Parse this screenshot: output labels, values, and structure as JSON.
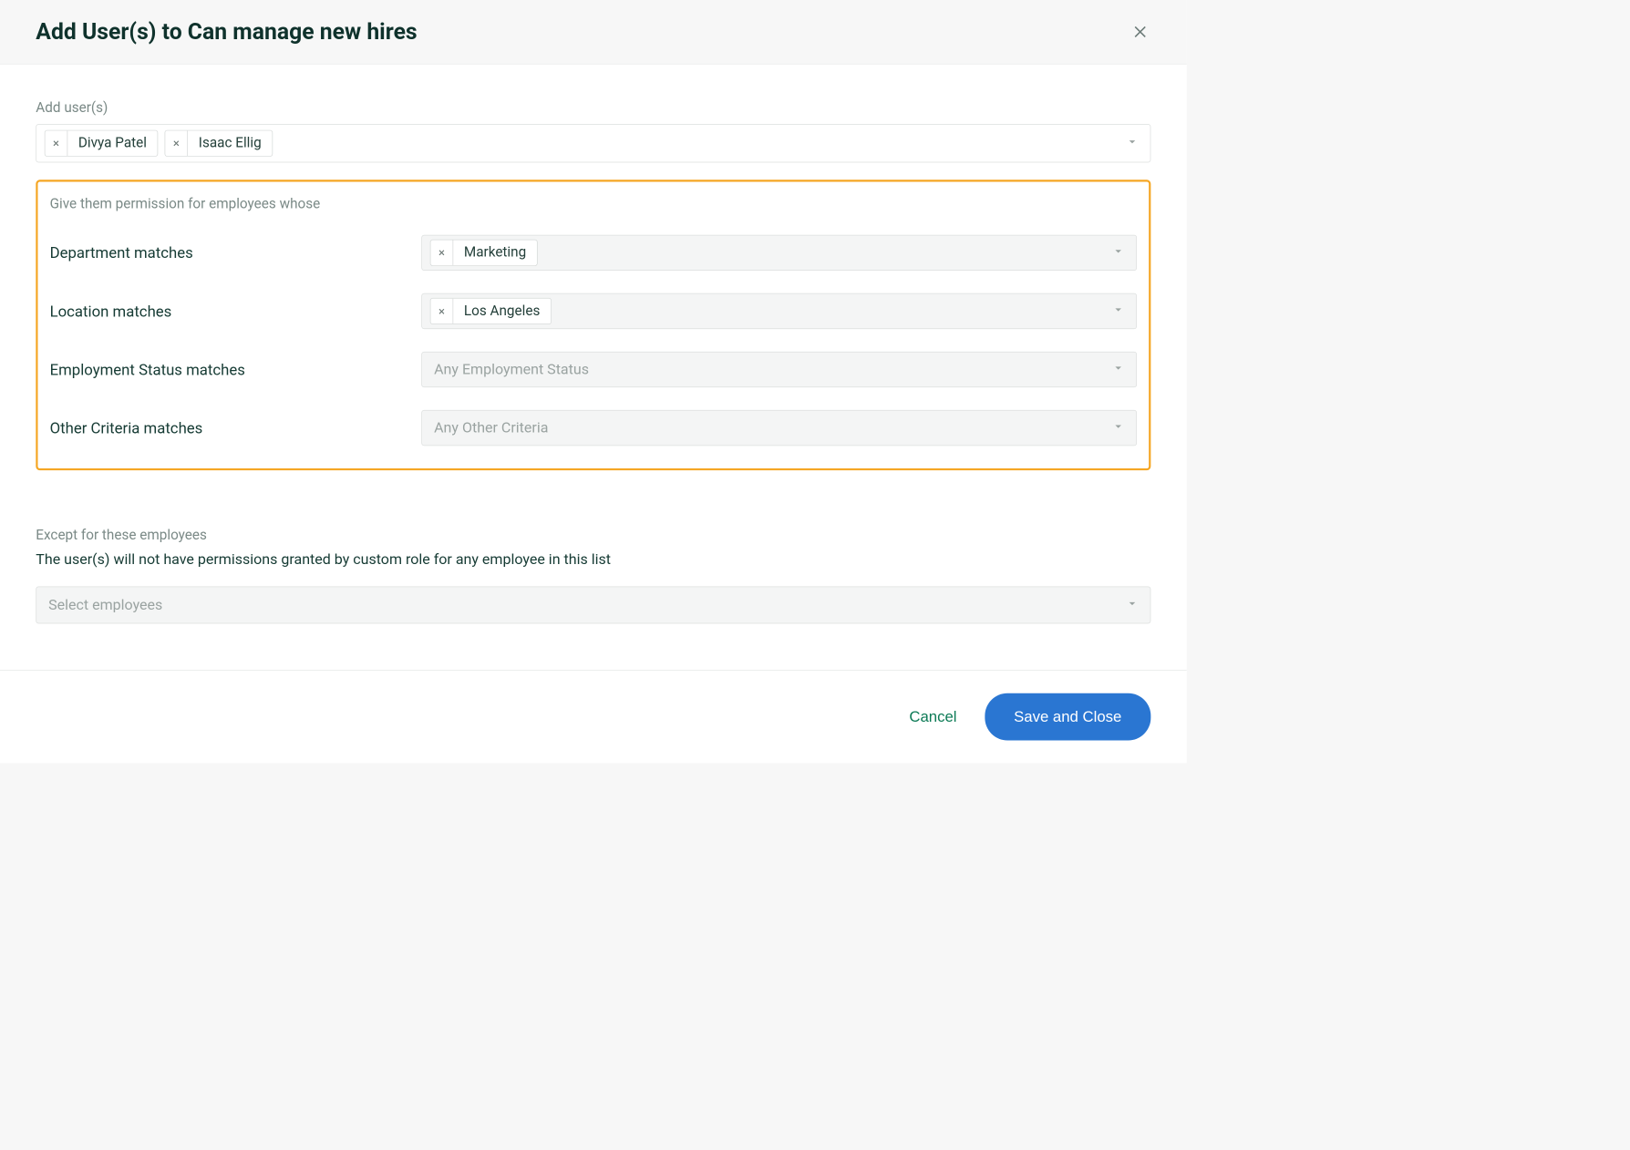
{
  "header": {
    "title": "Add User(s) to Can manage new hires"
  },
  "addUsers": {
    "label": "Add user(s)",
    "chips": [
      "Divya Patel",
      "Isaac Ellig"
    ]
  },
  "criteria": {
    "intro": "Give them permission for employees whose",
    "rows": [
      {
        "label": "Department matches",
        "chips": [
          "Marketing"
        ],
        "placeholder": ""
      },
      {
        "label": "Location matches",
        "chips": [
          "Los Angeles"
        ],
        "placeholder": ""
      },
      {
        "label": "Employment Status matches",
        "chips": [],
        "placeholder": "Any Employment Status"
      },
      {
        "label": "Other Criteria matches",
        "chips": [],
        "placeholder": "Any Other Criteria"
      }
    ]
  },
  "except": {
    "label": "Except for these employees",
    "desc": "The user(s) will not have permissions granted by custom role for any employee in this list",
    "placeholder": "Select employees"
  },
  "footer": {
    "cancel": "Cancel",
    "save": "Save and Close"
  }
}
